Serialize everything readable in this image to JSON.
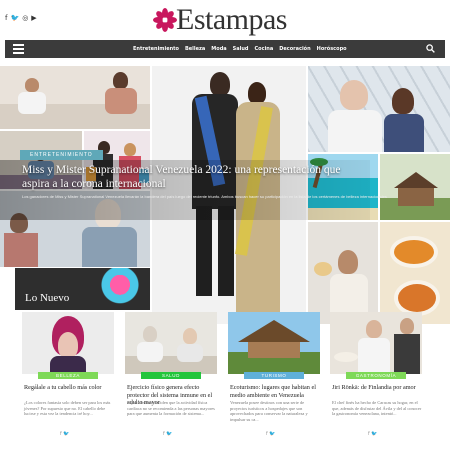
{
  "header": {
    "social": [
      "f",
      "🐦",
      "◎",
      "▶"
    ],
    "logo_text": "Estampas"
  },
  "nav": {
    "items": [
      "Entretenimiento",
      "Belleza",
      "Moda",
      "Salud",
      "Cocina",
      "Decoración",
      "Horóscopo"
    ]
  },
  "hero": {
    "category": "ENTRETENIMIENTO",
    "title": "Miss y Mister Supranational Venezuela 2022: una representación que aspira a la corona internacional",
    "excerpt": "Los ganadores de Miss y Mister Supranational Venezuela llevarán la bandera del país luego del reciente triunfo. Ambos buscan hacer su participación en la lista de los certámenes de belleza internacionales"
  },
  "section": {
    "title": "Lo Nuevo"
  },
  "cards": [
    {
      "category": "BELLEZA",
      "color": "#7ed957",
      "title": "Regálale a tu cabello más color",
      "excerpt": "¿Los colores fantasía solo deben ser para los más jóvenes? Por supuesto que no. El cabello debe lucirse y esta vez la tendencia iré hoy...",
      "share": "f  🐦"
    },
    {
      "category": "SALUD",
      "color": "#23c53c",
      "title": "Ejercicio físico genera efecto protector del sistema inmune en el adulto mayor",
      "excerpt": "Especialistas coinciden que la actividad física cardiaca no se recomienda a las personas mayores para que aumenta la formación de sistema...",
      "share": "f  🐦"
    },
    {
      "category": "TURISMO",
      "color": "#5fb0d9",
      "title": "Ecoturismo: lugares que habitan el medio ambiente en Venezuela",
      "excerpt": "Venezuela posee destinos con una serie de proyectos turísticos a hospedajes que son aprovechados para conservar la naturaleza y impulsar su ca...",
      "share": "f  🐦"
    },
    {
      "category": "GASTRONOMÍA",
      "color": "#7ed957",
      "title": "Jiri Rönkä: de Finlandia por amor",
      "excerpt": "El chef finés ha hecho de Caracas su hogar, en el que, además de disfrutar del Ávila y del al conocer la gastronomía venezolana, intentó...",
      "share": "f  🐦"
    }
  ],
  "colors": {
    "navbar": "#3b3b3b",
    "accent_pink": "#c8175d",
    "hero_pill": "#5fa8b8"
  }
}
